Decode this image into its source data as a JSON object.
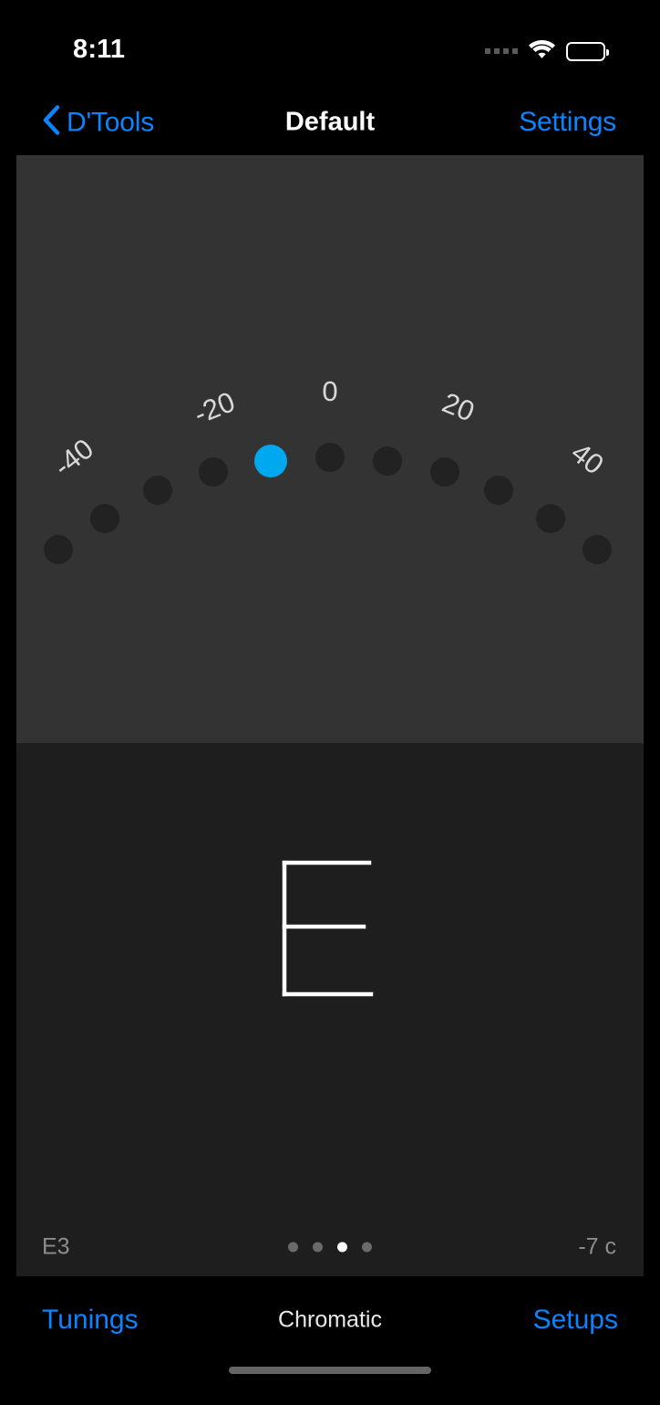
{
  "status_bar": {
    "time": "8:11",
    "signal_icon": "signal-dots-icon",
    "wifi_icon": "wifi-icon",
    "battery_icon": "battery-full-icon"
  },
  "nav_bar": {
    "back_icon": "chevron-left-icon",
    "back_label": "D'Tools",
    "title": "Default",
    "settings_label": "Settings"
  },
  "tuner": {
    "note_letter": "E",
    "note_name": "E3",
    "cents_readout": "-7 c",
    "active_dot_index": 4,
    "accent_color": "#00a8f0",
    "dot_color": "#222222",
    "dial_background": "#333333"
  },
  "chart_data": {
    "type": "scatter",
    "title": "",
    "xlabel": "cents",
    "ylabel": "",
    "categories": [
      "-48",
      "-40",
      "-32",
      "-24",
      "-16",
      "-8",
      "0",
      "8",
      "16",
      "24",
      "32",
      "40",
      "48"
    ],
    "values": [
      0,
      0,
      0,
      0,
      1,
      0,
      0,
      0,
      0,
      0,
      0,
      0,
      0
    ],
    "tick_labels": [
      "-40",
      "-20",
      "0",
      "20",
      "40"
    ],
    "tick_positions": [
      -40,
      -20,
      0,
      20,
      40
    ],
    "xlim": [
      -50,
      50
    ],
    "grid": false,
    "legend": "none",
    "annotations": [
      "active indicator at -8 cents (5th of 13 positions)"
    ],
    "series": [
      {
        "name": "inactive-dots",
        "values": [
          -48,
          -40,
          -32,
          -24,
          -16,
          0,
          8,
          16,
          24,
          32,
          40,
          48
        ]
      },
      {
        "name": "active-dot",
        "values": [
          -8
        ]
      }
    ]
  },
  "page_indicator": {
    "count": 4,
    "active_index": 2
  },
  "toolbar": {
    "left_label": "Tunings",
    "center_label": "Chromatic",
    "right_label": "Setups"
  }
}
